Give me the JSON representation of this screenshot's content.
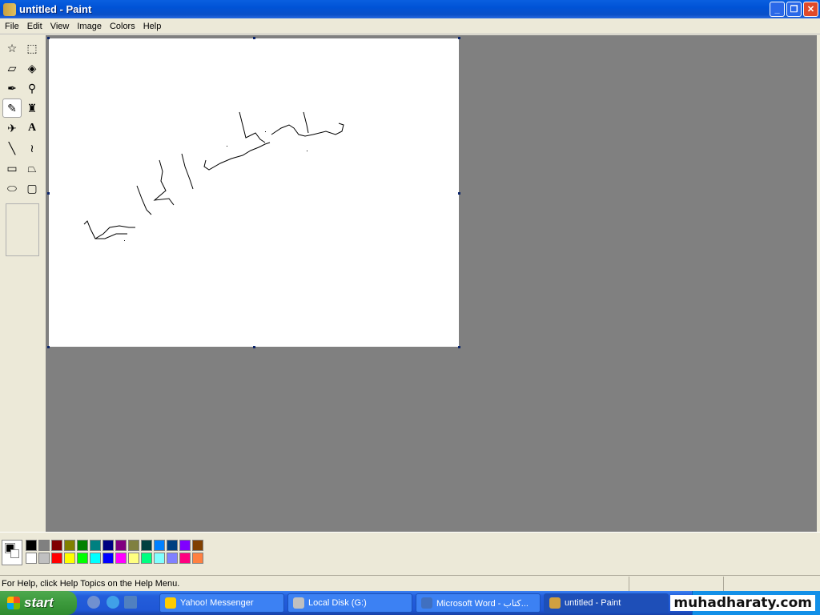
{
  "window": {
    "title": "untitled - Paint",
    "minimize": "_",
    "restore": "❐",
    "close": "✕"
  },
  "menu": [
    "File",
    "Edit",
    "View",
    "Image",
    "Colors",
    "Help"
  ],
  "tools": [
    {
      "name": "free-form-select",
      "glyph": "☆"
    },
    {
      "name": "rectangle-select",
      "glyph": "⬚"
    },
    {
      "name": "eraser",
      "glyph": "▱"
    },
    {
      "name": "fill-with-color",
      "glyph": "◈"
    },
    {
      "name": "pick-color",
      "glyph": "✒"
    },
    {
      "name": "magnifier",
      "glyph": "⚲"
    },
    {
      "name": "pencil",
      "glyph": "✎"
    },
    {
      "name": "brush",
      "glyph": "♜"
    },
    {
      "name": "airbrush",
      "glyph": "✈"
    },
    {
      "name": "text",
      "glyph": "A"
    },
    {
      "name": "line",
      "glyph": "╲"
    },
    {
      "name": "curve",
      "glyph": "≀"
    },
    {
      "name": "rectangle",
      "glyph": "▭"
    },
    {
      "name": "polygon",
      "glyph": "⏢"
    },
    {
      "name": "ellipse",
      "glyph": "⬭"
    },
    {
      "name": "rounded-rectangle",
      "glyph": "▢"
    }
  ],
  "selected_tool": "pencil",
  "palette": {
    "foreground": "#000000",
    "background": "#ffffff",
    "row1": [
      "#000000",
      "#808080",
      "#800000",
      "#808000",
      "#008000",
      "#008080",
      "#000080",
      "#800080",
      "#808040",
      "#004040",
      "#0080ff",
      "#004080",
      "#8000ff",
      "#804000"
    ],
    "row2": [
      "#ffffff",
      "#c0c0c0",
      "#ff0000",
      "#ffff00",
      "#00ff00",
      "#00ffff",
      "#0000ff",
      "#ff00ff",
      "#ffff80",
      "#00ff80",
      "#80ffff",
      "#8080ff",
      "#ff0080",
      "#ff8040"
    ]
  },
  "status": {
    "text": "For Help, click Help Topics on the Help Menu."
  },
  "taskbar": {
    "start": "start",
    "items": [
      {
        "label": "Yahoo! Messenger",
        "color": "#ffcc00"
      },
      {
        "label": "Local Disk (G:)",
        "color": "#c0c0c0"
      },
      {
        "label": "Microsoft Word - كتاب...",
        "color": "#4070c0"
      },
      {
        "label": "untitled - Paint",
        "color": "#d0a040"
      }
    ],
    "watermark": "muhadharaty.com"
  }
}
